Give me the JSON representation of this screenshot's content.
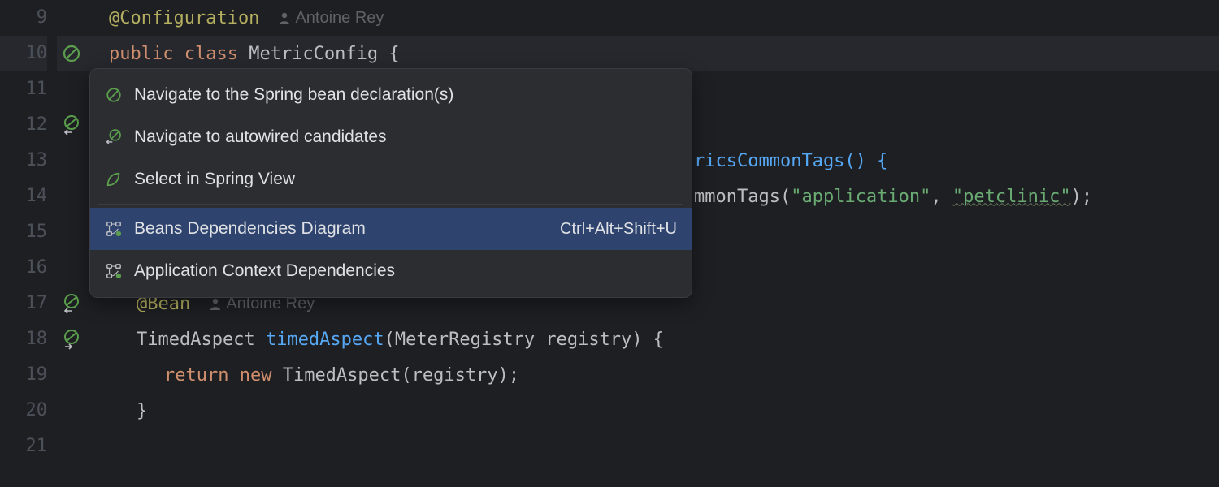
{
  "gutter": {
    "lines": [
      "9",
      "10",
      "11",
      "12",
      "13",
      "14",
      "15",
      "16",
      "17",
      "18",
      "19",
      "20",
      "21"
    ],
    "highlighted_line": "10"
  },
  "markers": {
    "line10": "spring-bean",
    "line12": "spring-bean-autowire",
    "line17": "spring-bean-autowire",
    "line18": "spring-bean-impl"
  },
  "author": {
    "name9": "Antoine Rey",
    "name17": "Antoine Rey"
  },
  "code": {
    "l9_ann": "@Configuration",
    "l10_kw1": "public ",
    "l10_kw2": "class ",
    "l10_name": "MetricConfig ",
    "l10_brace": "{",
    "l13_frag": "ricsCommonTags() {",
    "l14_frag1": "mmonTags(",
    "l14_s1": "\"application\"",
    "l14_c": ", ",
    "l14_s2": "\"petclinic\"",
    "l14_end": ");",
    "l17_ann": "@Bean",
    "l18_type": "TimedAspect ",
    "l18_meth": "timedAspect",
    "l18_sig": "(MeterRegistry registry) {",
    "l19_kwret": "return ",
    "l19_kwnew": "new ",
    "l19_call": "TimedAspect(registry);",
    "l20_brace": "}"
  },
  "popup": {
    "items": [
      {
        "icon": "navigate-bean",
        "label": "Navigate to the Spring bean declaration(s)",
        "shortcut": "",
        "selected": false
      },
      {
        "icon": "navigate-autowire",
        "label": "Navigate to autowired candidates",
        "shortcut": "",
        "selected": false
      },
      {
        "icon": "spring-view",
        "label": "Select in Spring View",
        "shortcut": "",
        "selected": false
      },
      {
        "sep": true
      },
      {
        "icon": "diagram",
        "label": "Beans Dependencies Diagram",
        "shortcut": "Ctrl+Alt+Shift+U",
        "selected": true
      },
      {
        "icon": "diagram",
        "label": "Application Context Dependencies",
        "shortcut": "",
        "selected": false
      }
    ]
  }
}
